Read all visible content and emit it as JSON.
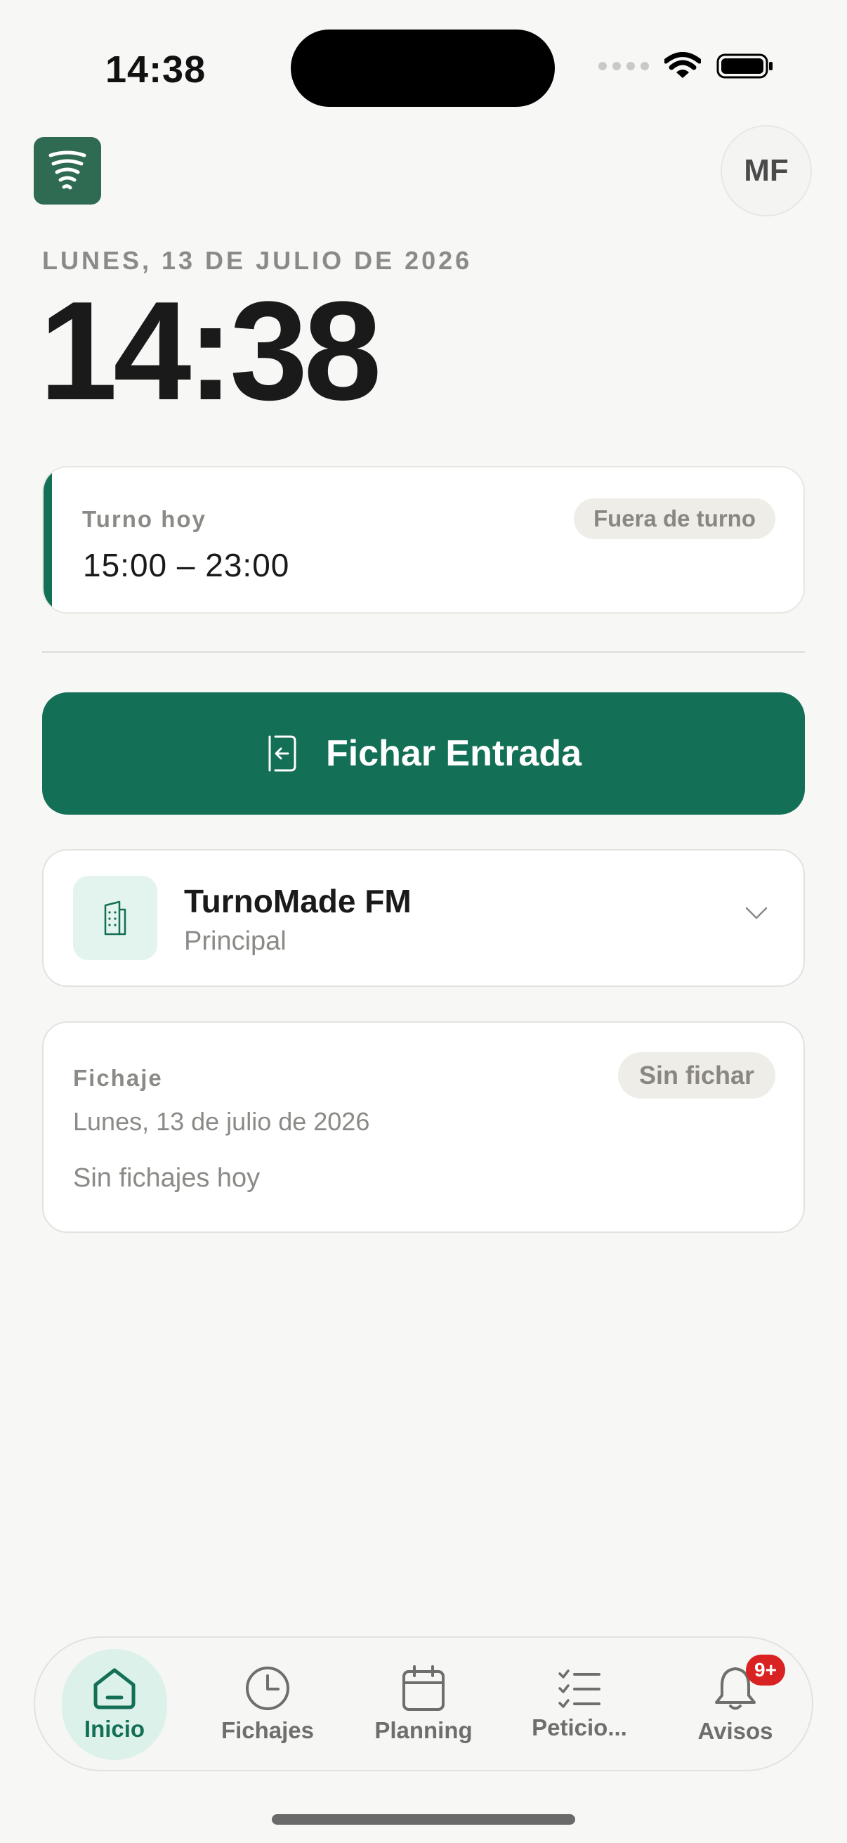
{
  "status_bar": {
    "time": "14:38"
  },
  "header": {
    "avatar_initials": "MF",
    "logo_icon": "tornado-icon"
  },
  "today": {
    "date_label": "LUNES, 13 DE JULIO DE 2026",
    "clock": "14:38"
  },
  "shift": {
    "label": "Turno hoy",
    "hours": "15:00 – 23:00",
    "status": "Fuera de turno"
  },
  "clock_in": {
    "label": "Fichar Entrada",
    "icon": "sign-in-icon"
  },
  "company": {
    "name": "TurnoMade FM",
    "subtitle": "Principal",
    "icon": "building-icon"
  },
  "record": {
    "title": "Fichaje",
    "status": "Sin fichar",
    "date": "Lunes, 13 de julio de 2026",
    "empty_text": "Sin fichajes hoy"
  },
  "tabs": [
    {
      "label": "Inicio",
      "icon": "home-icon",
      "active": true
    },
    {
      "label": "Fichajes",
      "icon": "clock-icon"
    },
    {
      "label": "Planning",
      "icon": "calendar-icon"
    },
    {
      "label": "Peticio...",
      "icon": "checklist-icon"
    },
    {
      "label": "Avisos",
      "icon": "bell-icon",
      "badge": "9+"
    }
  ],
  "colors": {
    "accent": "#136f55",
    "accent_light": "#dcf1ea",
    "badge_red": "#d92222",
    "background": "#f7f7f5"
  }
}
